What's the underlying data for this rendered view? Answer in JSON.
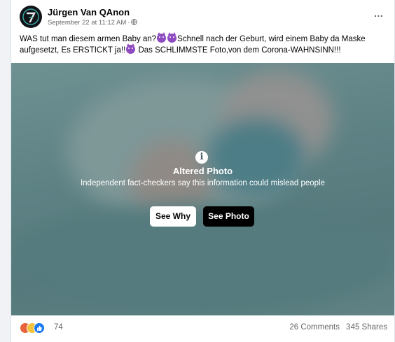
{
  "post": {
    "author": "Jürgen Van QAnon",
    "timestamp": "September 22 at 11:12 AM",
    "text_segments": [
      "WAS tut man diesem armen Baby an?",
      "Schnell nach der Geburt, wird einem Baby da Maske aufgesetzt, Es ERSTICKT ja!!",
      " Das SCHLIMMSTE Foto,von dem Corona-WAHNSINN!!!"
    ],
    "more_icon": "…"
  },
  "fact_check": {
    "icon": "i",
    "title": "Altered Photo",
    "subtitle": "Independent fact-checkers say this information could mislead people",
    "see_why_label": "See Why",
    "see_photo_label": "See Photo"
  },
  "footer": {
    "reaction_icons": [
      "angry-icon",
      "sad-icon",
      "like-icon"
    ],
    "reaction_count": "74",
    "comments": "26 Comments",
    "shares": "345 Shares"
  },
  "colors": {
    "accent": "#1877f2",
    "secondary_text": "#65676b",
    "emoji": "#8e4cc0"
  }
}
